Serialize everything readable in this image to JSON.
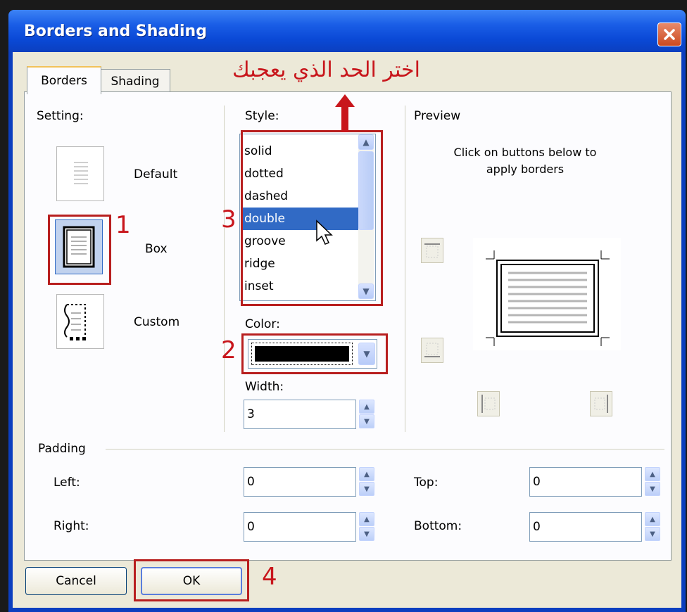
{
  "window": {
    "title": "Borders and Shading"
  },
  "tabs": [
    {
      "label": "Borders",
      "active": true
    },
    {
      "label": "Shading",
      "active": false
    }
  ],
  "annotation": {
    "text": "اختر الحد الذي يعجبك",
    "color": "#c8161c"
  },
  "setting": {
    "label": "Setting:",
    "options": [
      {
        "label": "Default"
      },
      {
        "label": "Box",
        "selected": true
      },
      {
        "label": "Custom"
      }
    ]
  },
  "style": {
    "label": "Style:",
    "items": [
      "solid",
      "dotted",
      "dashed",
      "double",
      "groove",
      "ridge",
      "inset"
    ],
    "selected": "double"
  },
  "color": {
    "label": "Color:",
    "value": "#000000"
  },
  "width": {
    "label": "Width:",
    "value": "3"
  },
  "preview": {
    "label": "Preview",
    "hint": "Click on buttons below to apply borders"
  },
  "padding": {
    "label": "Padding",
    "left": {
      "label": "Left:",
      "value": "0"
    },
    "right": {
      "label": "Right:",
      "value": "0"
    },
    "top": {
      "label": "Top:",
      "value": "0"
    },
    "bottom": {
      "label": "Bottom:",
      "value": "0"
    }
  },
  "buttons": {
    "cancel": "Cancel",
    "ok": "OK"
  },
  "step_numbers": {
    "one": "1",
    "two": "2",
    "three": "3",
    "four": "4"
  },
  "colors": {
    "accent": "#316ac5",
    "highlight": "#b81f1f",
    "titlebar": "#0a49d6"
  }
}
